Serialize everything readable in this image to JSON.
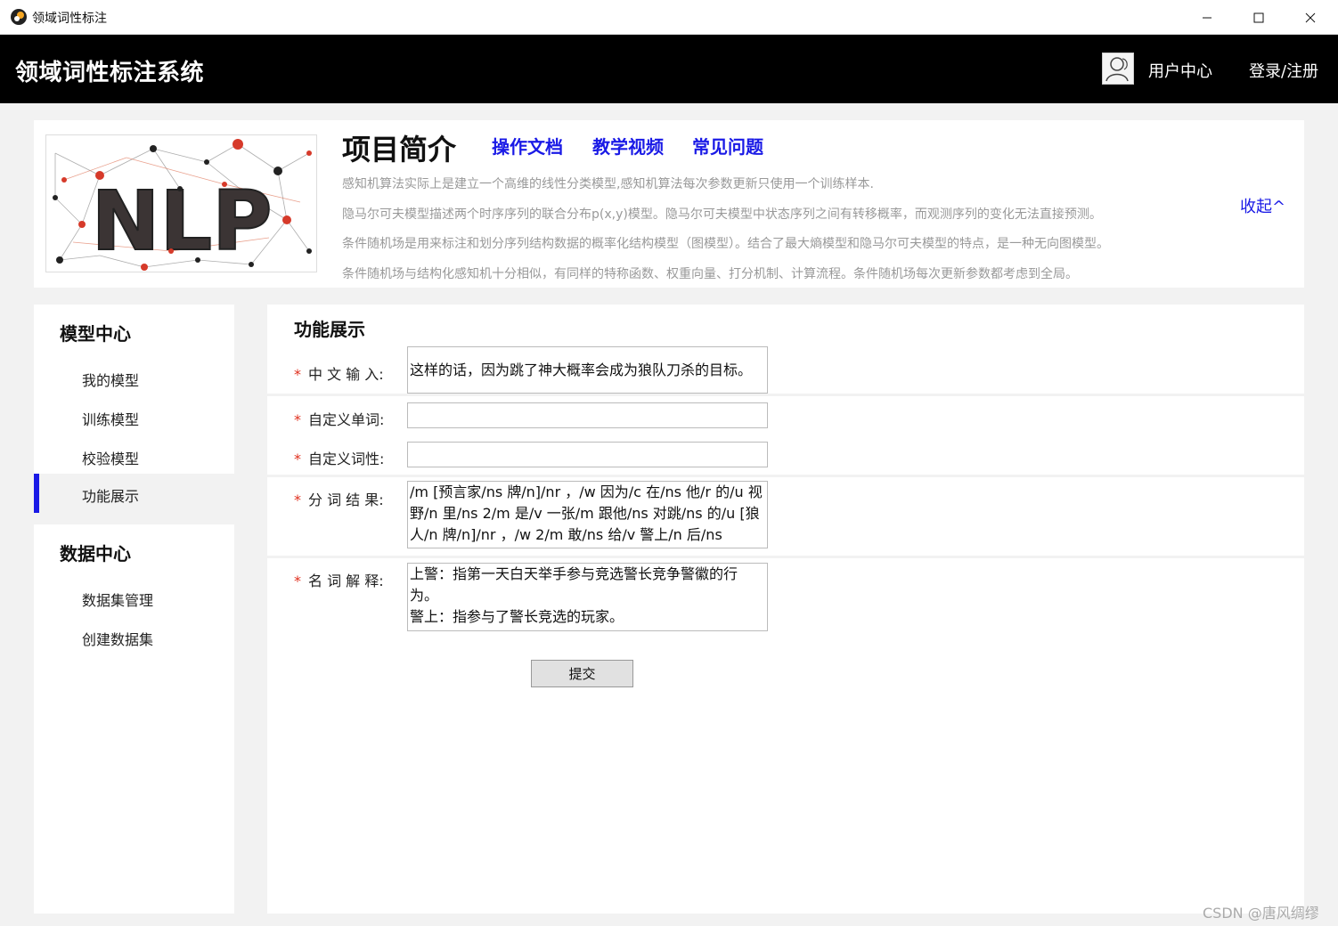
{
  "window": {
    "title": "领域词性标注"
  },
  "header": {
    "brand": "领域词性标注系统",
    "user_center": "用户中心",
    "login": "登录/注册"
  },
  "intro": {
    "image_text": "NLP",
    "title": "项目简介",
    "links": [
      "操作文档",
      "教学视频",
      "常见问题"
    ],
    "lines": [
      "感知机算法实际上是建立一个高维的线性分类模型,感知机算法每次参数更新只使用一个训练样本.",
      "隐马尔可夫模型描述两个时序序列的联合分布p(x,y)模型。隐马尔可夫模型中状态序列之间有转移概率，而观测序列的变化无法直接预测。",
      "条件随机场是用来标注和划分序列结构数据的概率化结构模型（图模型）。结合了最大熵模型和隐马尔可夫模型的特点，是一种无向图模型。",
      "条件随机场与结构化感知机十分相似，有同样的特称函数、权重向量、打分机制、计算流程。条件随机场每次更新参数都考虑到全局。"
    ],
    "collapse": "收起^"
  },
  "sidebar": {
    "model_center": {
      "heading": "模型中心",
      "items": [
        "我的模型",
        "训练模型",
        "校验模型",
        "功能展示"
      ]
    },
    "data_center": {
      "heading": "数据中心",
      "items": [
        "数据集管理",
        "创建数据集"
      ]
    }
  },
  "main": {
    "title": "功能展示",
    "fields": {
      "chinese_input": {
        "label": "中 文 输 入:",
        "value": "这样的话，因为跳了神大概率会成为狼队刀杀的目标。"
      },
      "custom_word": {
        "label": "自定义单词:",
        "value": ""
      },
      "custom_pos": {
        "label": "自定义词性:",
        "value": ""
      },
      "seg_result": {
        "label": "分 词 结 果:",
        "value": "/m [预言家/ns 牌/n]/nr ，/w 因为/c 在/ns 他/r 的/u 视野/n 里/ns 2/m 是/v 一张/m 跟他/ns 对跳/ns 的/u [狼人/n 牌/n]/nr ，/w 2/m 敢/ns 给/v 警上/n 后/ns"
      },
      "term_explain": {
        "label": "名 词 解 释:",
        "value": "上警：指第一天白天举手参与竞选警长竞争警徽的行为。\n警上：指参与了警长竞选的玩家。"
      }
    },
    "submit": "提交"
  },
  "watermark": "CSDN @唐风绸缪"
}
